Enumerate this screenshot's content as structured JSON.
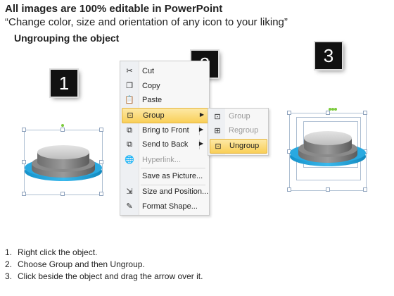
{
  "header": {
    "title": "All images are 100% editable in PowerPoint",
    "subtitle": "“Change color, size and orientation of any icon to your liking”",
    "section": "Ungrouping the object"
  },
  "badges": [
    "1",
    "2",
    "3"
  ],
  "context_menu": {
    "items": [
      {
        "label": "Cut",
        "icon": "scissors-icon",
        "glyph": "✂"
      },
      {
        "label": "Copy",
        "icon": "copy-icon",
        "glyph": "❐"
      },
      {
        "label": "Paste",
        "icon": "paste-icon",
        "glyph": "📋"
      },
      {
        "label": "Group",
        "icon": "group-icon",
        "glyph": "⊡",
        "highlighted": true,
        "submenu": true
      },
      {
        "label": "Bring to Front",
        "icon": "bring-to-front-icon",
        "glyph": "⧉",
        "submenu": true
      },
      {
        "label": "Send to Back",
        "icon": "send-to-back-icon",
        "glyph": "⧉",
        "submenu": true
      },
      {
        "label": "Hyperlink...",
        "icon": "hyperlink-icon",
        "glyph": "🌐",
        "disabled": true
      },
      {
        "label": "Save as Picture...",
        "icon": "",
        "glyph": ""
      },
      {
        "label": "Size and Position...",
        "icon": "size-position-icon",
        "glyph": "⇲"
      },
      {
        "label": "Format Shape...",
        "icon": "format-shape-icon",
        "glyph": "✎"
      }
    ]
  },
  "submenu": {
    "items": [
      {
        "label": "Group",
        "icon": "group-icon",
        "glyph": "⊡",
        "disabled": true
      },
      {
        "label": "Regroup",
        "icon": "regroup-icon",
        "glyph": "⊞",
        "disabled": true
      },
      {
        "label": "Ungroup",
        "icon": "ungroup-icon",
        "glyph": "⊡",
        "highlighted": true
      }
    ]
  },
  "steps": [
    {
      "num": "1.",
      "text": "Right click the object."
    },
    {
      "num": "2.",
      "text": "Choose Group and then Ungroup."
    },
    {
      "num": "3.",
      "text": "Click beside the object and drag the arrow over it."
    }
  ],
  "colors": {
    "accent_blue": "#29a9e0",
    "disc_gray": "#9d9d9d",
    "menu_highlight": "#f9cf58",
    "handle_green": "#7ccb3d"
  }
}
